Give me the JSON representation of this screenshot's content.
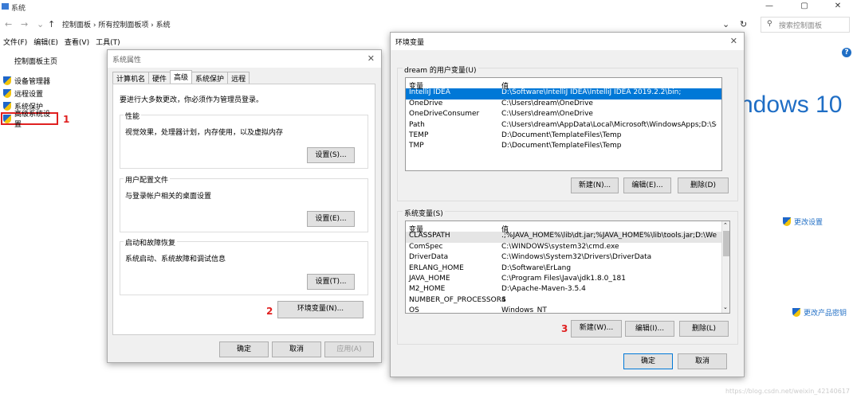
{
  "window": {
    "title": "系统",
    "controls": [
      "—",
      "▢",
      "✕"
    ]
  },
  "address": {
    "crumbs": "控制面板 › 所有控制面板项 › 系统",
    "search_placeholder": "搜索控制面板"
  },
  "menubar": [
    "文件(F)",
    "编辑(E)",
    "查看(V)",
    "工具(T)"
  ],
  "leftnav": {
    "home": "控制面板主页",
    "items": [
      "设备管理器",
      "远程设置",
      "系统保护",
      "高级系统设置"
    ],
    "step_label": "1"
  },
  "main": {
    "windows_logo_text": "ndows 10",
    "change_settings": "更改设置",
    "change_product_key": "更改产品密钥",
    "help": "?"
  },
  "sysprops": {
    "title": "系统属性",
    "tabs": [
      "计算机名",
      "硬件",
      "高级",
      "系统保护",
      "远程"
    ],
    "admin_note": "要进行大多数更改，你必须作为管理员登录。",
    "groups": [
      {
        "label": "性能",
        "desc": "视觉效果，处理器计划，内存使用，以及虚拟内存",
        "button": "设置(S)..."
      },
      {
        "label": "用户配置文件",
        "desc": "与登录帐户相关的桌面设置",
        "button": "设置(E)..."
      },
      {
        "label": "启动和故障恢复",
        "desc": "系统启动、系统故障和调试信息",
        "button": "设置(T)..."
      }
    ],
    "env_button": "环境变量(N)...",
    "step_label": "2",
    "ok": "确定",
    "cancel": "取消",
    "apply": "应用(A)"
  },
  "envvars": {
    "title": "环境变量",
    "user_group": "dream 的用户变量(U)",
    "col_var": "变量",
    "col_val": "值",
    "user_rows": [
      [
        "IntelliJ IDEA",
        "D:\\Software\\IntelliJ IDEA\\IntelliJ IDEA 2019.2.2\\bin;"
      ],
      [
        "OneDrive",
        "C:\\Users\\dream\\OneDrive"
      ],
      [
        "OneDriveConsumer",
        "C:\\Users\\dream\\OneDrive"
      ],
      [
        "Path",
        "C:\\Users\\dream\\AppData\\Local\\Microsoft\\WindowsApps;D:\\So..."
      ],
      [
        "TEMP",
        "D:\\Document\\TemplateFiles\\Temp"
      ],
      [
        "TMP",
        "D:\\Document\\TemplateFiles\\Temp"
      ]
    ],
    "user_buttons": [
      "新建(N)...",
      "编辑(E)...",
      "删除(D)"
    ],
    "sys_group": "系统变量(S)",
    "sys_rows": [
      [
        "CLASSPATH",
        ".;%JAVA_HOME%\\lib\\dt.jar;%JAVA_HOME%\\lib\\tools.jar;D:\\Wea..."
      ],
      [
        "ComSpec",
        "C:\\WINDOWS\\system32\\cmd.exe"
      ],
      [
        "DriverData",
        "C:\\Windows\\System32\\Drivers\\DriverData"
      ],
      [
        "ERLANG_HOME",
        "D:\\Software\\ErLang"
      ],
      [
        "JAVA_HOME",
        "C:\\Program Files\\Java\\jdk1.8.0_181"
      ],
      [
        "M2_HOME",
        "D:\\Apache-Maven-3.5.4"
      ],
      [
        "NUMBER_OF_PROCESSORS",
        "4"
      ],
      [
        "OS",
        "Windows_NT"
      ]
    ],
    "sys_buttons": [
      "新建(W)...",
      "编辑(I)...",
      "删除(L)"
    ],
    "step_label": "3",
    "ok": "确定",
    "cancel": "取消"
  },
  "watermark": "https://blog.csdn.net/weixin_42140617"
}
